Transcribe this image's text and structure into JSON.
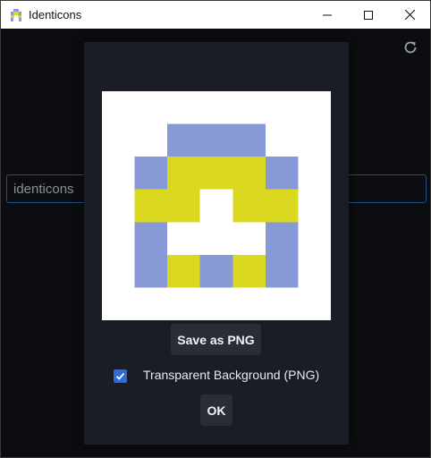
{
  "window": {
    "title": "Identicons"
  },
  "main": {
    "search_value": "identicons"
  },
  "dialog": {
    "save_label": "Save as PNG",
    "transparent_label": "Transparent Background (PNG)",
    "transparent_checked": true,
    "ok_label": "OK"
  },
  "identicon": {
    "colors": {
      "yellow": "#dbd820",
      "blue": "#8899d8",
      "background": "#ffffff"
    },
    "grid": [
      [
        ".",
        ".",
        ".",
        ".",
        ".",
        ".",
        "."
      ],
      [
        ".",
        ".",
        "B",
        "B",
        "B",
        ".",
        "."
      ],
      [
        ".",
        "B",
        "Y",
        "Y",
        "Y",
        "B",
        "."
      ],
      [
        ".",
        "Y",
        "Y",
        ".",
        "Y",
        "Y",
        "."
      ],
      [
        ".",
        "B",
        ".",
        ".",
        ".",
        "B",
        "."
      ],
      [
        ".",
        "B",
        "Y",
        "B",
        "Y",
        "B",
        "."
      ],
      [
        ".",
        ".",
        ".",
        ".",
        ".",
        ".",
        "."
      ]
    ]
  },
  "colors": {
    "accent": "#2e6bd8",
    "dialog_bg": "#1a1d25",
    "button_bg": "#2a2d35",
    "input_border": "#1f4e8a"
  }
}
